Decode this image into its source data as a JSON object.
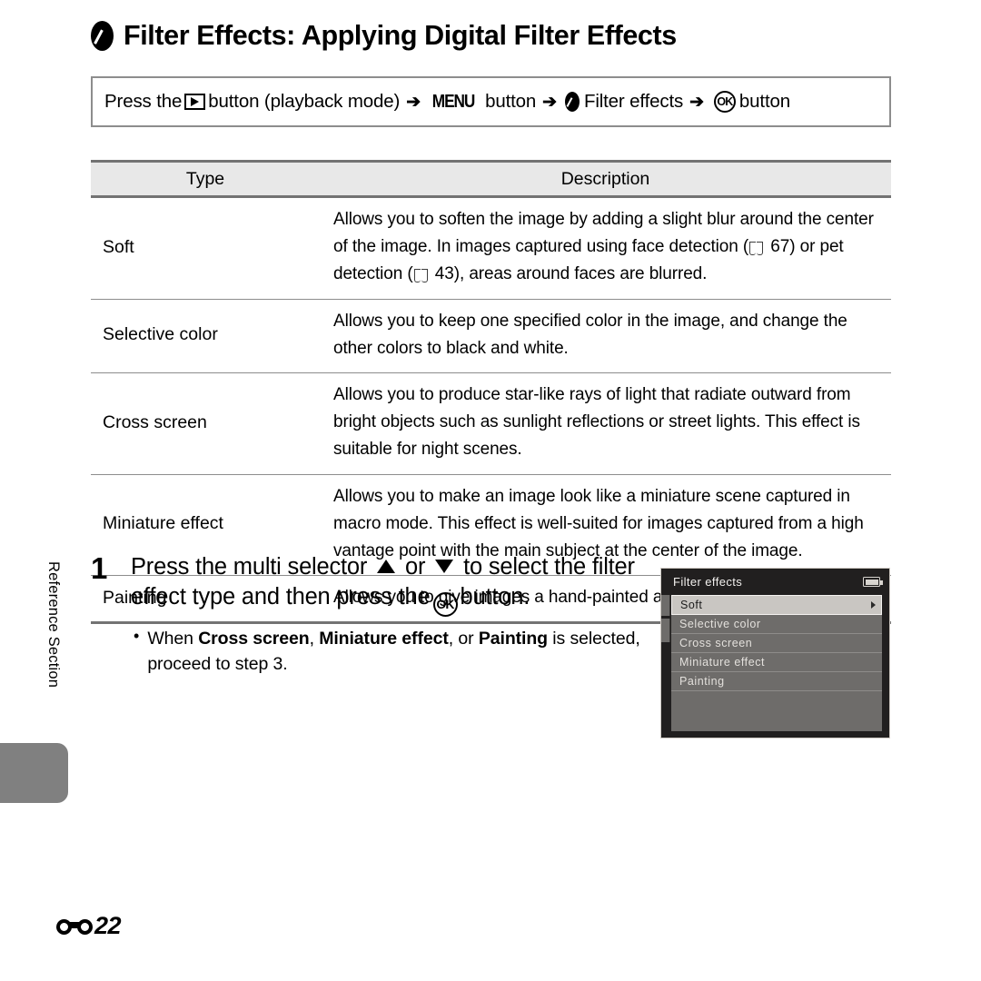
{
  "page": {
    "title": "Filter Effects: Applying Digital Filter Effects",
    "title_icon": "filter-effects-icon",
    "folio_number": "22",
    "folio_icon": "reference-section-symbol",
    "side_label": "Reference Section"
  },
  "path_bar": {
    "segment_1": "Press the",
    "icon_1": "playback-button-icon",
    "segment_2": "button (playback mode)",
    "arrow_1": "➔",
    "icon_2": "MENU",
    "segment_3": "button",
    "arrow_2": "➔",
    "icon_3": "filter-effects-icon",
    "segment_4": "Filter effects",
    "arrow_3": "➔",
    "icon_4": "OK",
    "segment_5": "button"
  },
  "table": {
    "headers": [
      "Type",
      "Description"
    ],
    "rows": [
      {
        "type": "Soft",
        "description_parts": [
          "Allows you to soften the image by adding a slight blur around the center of the image. In images captured using face detection (",
          "book-icon",
          " 67) or pet detection (",
          "book-icon",
          " 43), areas around faces are blurred."
        ],
        "description": "Allows you to soften the image by adding a slight blur around the center of the image. In images captured using face detection ( 67) or pet detection ( 43), areas around faces are blurred.",
        "refs": [
          "67",
          "43"
        ]
      },
      {
        "type": "Selective color",
        "description": "Allows you to keep one specified color in the image, and change the other colors to black and white.",
        "refs": []
      },
      {
        "type": "Cross screen",
        "description": "Allows you to produce star-like rays of light that radiate outward from bright objects such as sunlight reflections or street lights. This effect is suitable for night scenes.",
        "refs": []
      },
      {
        "type": "Miniature effect",
        "description": "Allows you to make an image look like a miniature scene captured in macro mode. This effect is well-suited for images captured from a high vantage point with the main subject at the center of the image.",
        "refs": []
      },
      {
        "type": "Painting",
        "description": "Allows you to give images a hand-painted appearance.",
        "refs": []
      }
    ]
  },
  "step": {
    "number": "1",
    "line_a": "Press the multi selector",
    "up_icon": "triangle-up-icon",
    "or_word": "or",
    "down_icon": "triangle-down-icon",
    "line_b": "to select the filter effect type and then press the",
    "ok_icon": "OK",
    "line_c": "button.",
    "bullet_prefix": "When",
    "bullet_bold_1": "Cross screen",
    "bullet_sep_1": ",",
    "bullet_bold_2": "Miniature effect",
    "bullet_sep_2": ", or",
    "bullet_bold_3": "Painting",
    "bullet_suffix": "is selected, proceed to step 3."
  },
  "lcd": {
    "title": "Filter effects",
    "battery_icon": "battery-full-icon",
    "items": [
      {
        "label": "Soft",
        "selected": true
      },
      {
        "label": "Selective color",
        "selected": false
      },
      {
        "label": "Cross screen",
        "selected": false
      },
      {
        "label": "Miniature effect",
        "selected": false
      },
      {
        "label": "Painting",
        "selected": false
      }
    ]
  },
  "colors": {
    "rule": "#737373",
    "thin_rule": "#8d8d8d",
    "header_fill": "#e8e8e8",
    "lcd_bg": "#211f1f",
    "lcd_list_bg": "#6e6c6a",
    "lcd_selected_bg": "#c9c6c2",
    "side_tab": "#808080"
  }
}
